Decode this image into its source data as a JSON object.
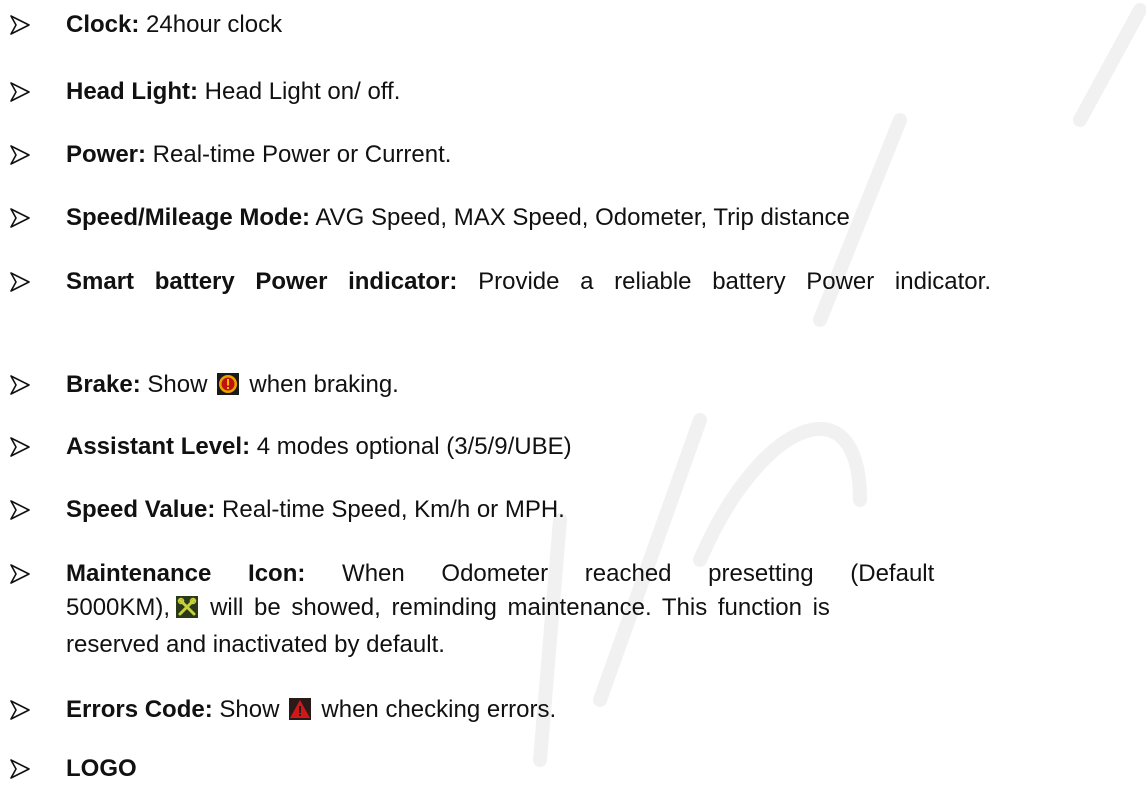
{
  "items": [
    {
      "label": "Clock:",
      "text": " 24hour clock"
    },
    {
      "label": "Head Light:",
      "text": " Head Light on/ off."
    },
    {
      "label": "Power:",
      "text": " Real-time Power or Current."
    },
    {
      "label": "Speed/Mileage Mode:",
      "text": " AVG Speed, MAX Speed, Odometer, Trip distance"
    },
    {
      "label": "Smart battery Power indicator:",
      "text": " Provide a reliable battery Power indicator."
    },
    {
      "label": "Brake:",
      "text_before": " Show",
      "icon": "brake-warning-icon",
      "text_after": "when braking."
    },
    {
      "label": "Assistant Level:",
      "text": " 4 modes optional (3/5/9/UBE)"
    },
    {
      "label": "Speed Value:",
      "text": " Real-time Speed, Km/h or MPH."
    },
    {
      "label": "Maintenance Icon:",
      "text_line1": " When Odometer reached presetting (Default",
      "text_line2_before": "5000KM),",
      "icon": "wrench-maintenance-icon",
      "text_line2_after": "will be showed, reminding maintenance. This function is",
      "text_line3": "reserved and inactivated by default."
    },
    {
      "label": "Errors Code:",
      "text_before": " Show",
      "icon": "error-warning-triangle-icon",
      "text_after": "when checking errors."
    },
    {
      "label": "LOGO"
    }
  ],
  "colors": {
    "text": "#111111",
    "watermark": "#f3f3f3",
    "brake_icon_bg": "#e8a300",
    "brake_icon_fg": "#c01010",
    "maintenance_icon_bg": "#2a3a18",
    "maintenance_icon_fg": "#c9d23c",
    "error_icon_bg": "#2a1a1a",
    "error_icon_fg": "#d01818"
  }
}
